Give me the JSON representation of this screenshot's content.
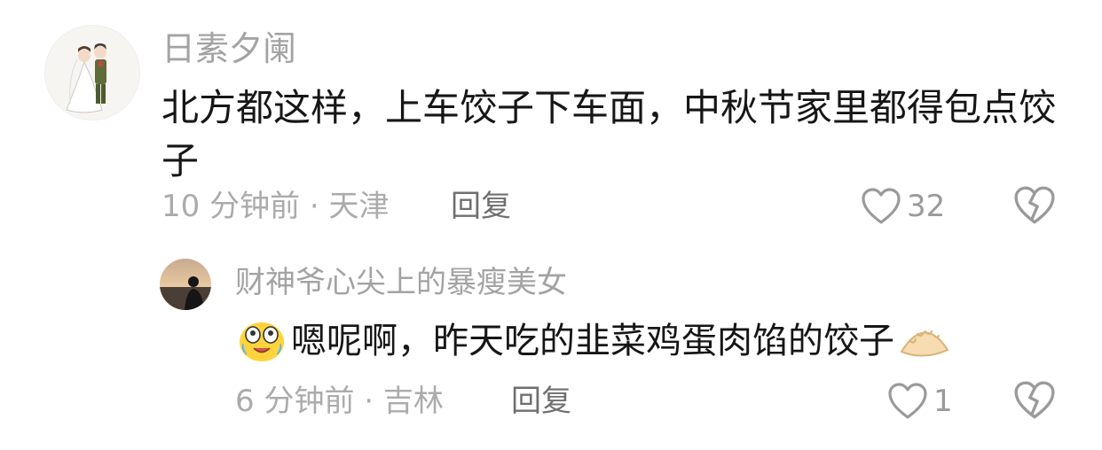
{
  "comments": {
    "main": {
      "username": "日素夕阑",
      "text": "北方都这样，上车饺子下车面，中秋节家里都得包点饺子",
      "meta": "10 分钟前 · 天津",
      "reply_label": "回复",
      "like_count": "32",
      "avatar_icon": "bride-groom-avatar-icon"
    },
    "reply": {
      "username": "财神爷心尖上的暴瘦美女",
      "text": "嗯呢啊，昨天吃的韭菜鸡蛋肉馅的饺子",
      "leading_emoji": "teary-smile-emoji",
      "trailing_emoji": "dumpling-emoji",
      "meta": "6 分钟前 · 吉林",
      "reply_label": "回复",
      "like_count": "1",
      "avatar_icon": "silhouette-sunset-avatar-icon"
    }
  },
  "colors": {
    "username": "#a3a3a3",
    "text": "#161616",
    "meta": "#ababab",
    "reply_button": "#6f6f6f",
    "icon": "#9a9a9a"
  }
}
